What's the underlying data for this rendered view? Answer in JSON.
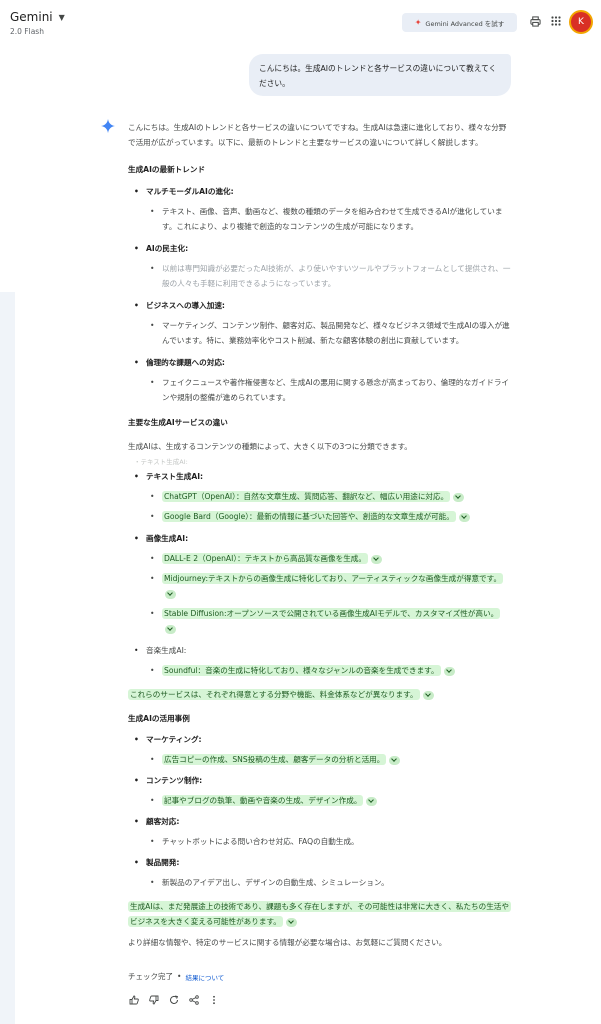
{
  "header": {
    "app_name": "Gemini",
    "model": "2.0 Flash",
    "advanced_label": "Gemini Advanced を試す",
    "avatar_letter": "K",
    "avatar_color": "#d93025"
  },
  "user_message": "こんにちは。生成AIのトレンドと各サービスの違いについて教えてください。",
  "response": {
    "intro": "こんにちは。生成AIのトレンドと各サービスの違いについてですね。生成AIは急速に進化しており、様々な分野で活用が広がっています。以下に、最新のトレンドと主要なサービスの違いについて詳しく解説します。",
    "trends_heading": "生成AIの最新トレンド",
    "trends": [
      {
        "title": "マルチモーダルAIの進化:",
        "detail": "テキスト、画像、音声、動画など、複数の種類のデータを組み合わせて生成できるAIが進化しています。これにより、より複雑で創造的なコンテンツの生成が可能になります。"
      },
      {
        "title": "AIの民主化:",
        "detail": "以前は専門知識が必要だったAI技術が、より使いやすいツールやプラットフォームとして提供され、一般の人々も手軽に利用できるようになっています。"
      },
      {
        "title": "ビジネスへの導入加速:",
        "detail": "マーケティング、コンテンツ制作、顧客対応、製品開発など、様々なビジネス領域で生成AIの導入が進んでいます。特に、業務効率化やコスト削減、新たな顧客体験の創出に貢献しています。"
      },
      {
        "title": "倫理的な課題への対応:",
        "detail": "フェイクニュースや著作権侵害など、生成AIの悪用に関する懸念が高まっており、倫理的なガイドラインや規制の整備が進められています。"
      }
    ],
    "services_heading": "主要な生成AIサービスの違い",
    "services_intro": "生成AIは、生成するコンテンツの種類によって、大きく以下の3つに分類できます。",
    "ghost_line": "・テキスト生成AI:",
    "text_ai": {
      "title": "テキスト生成AI:",
      "items": [
        "ChatGPT（OpenAI）：自然な文章生成、質問応答、翻訳など、幅広い用途に対応。",
        "Google Bard（Google）：最新の情報に基づいた回答や、創造的な文章生成が可能。"
      ]
    },
    "image_ai": {
      "title": "画像生成AI:",
      "items": [
        "DALL-E 2（OpenAI）：テキストから高品質な画像を生成。",
        "Midjourney:テキストからの画像生成に特化しており、アーティスティックな画像生成が得意です。",
        "Stable Diffusion:オープンソースで公開されている画像生成AIモデルで、カスタマイズ性が高い。"
      ]
    },
    "music_ai": {
      "title": "音楽生成AI:",
      "items": [
        "Soundful：音楽の生成に特化しており、様々なジャンルの音楽を生成できます。"
      ]
    },
    "services_summary": "これらのサービスは、それぞれ得意とする分野や機能、料金体系などが異なります。",
    "use_heading": "生成AIの活用事例",
    "uses": [
      {
        "title": "マーケティング:",
        "detail": "広告コピーの作成、SNS投稿の生成、顧客データの分析と活用。",
        "highlight": true
      },
      {
        "title": "コンテンツ制作:",
        "detail": "記事やブログの執筆、動画や音楽の生成、デザイン作成。",
        "highlight": true
      },
      {
        "title": "顧客対応:",
        "detail": "チャットボットによる問い合わせ対応、FAQの自動生成。",
        "highlight": false
      },
      {
        "title": "製品開発:",
        "detail": "新製品のアイデア出し、デザインの自動生成、シミュレーション。",
        "highlight": false
      }
    ],
    "conclusion": "生成AIは、まだ発展途上の技術であり、課題も多く存在しますが、その可能性は非常に大きく、私たちの生活やビジネスを大きく変える可能性があります。",
    "closing": "より詳細な情報や、特定のサービスに関する情報が必要な場合は、お気軽にご質問ください。"
  },
  "footer": {
    "check_label": "チェック完了",
    "check_separator": "•",
    "result_link": "結果について"
  },
  "colors": {
    "highlight_bg": "#d6f5d6",
    "highlight_text": "#1e5b22",
    "spark": "#4285f4"
  }
}
